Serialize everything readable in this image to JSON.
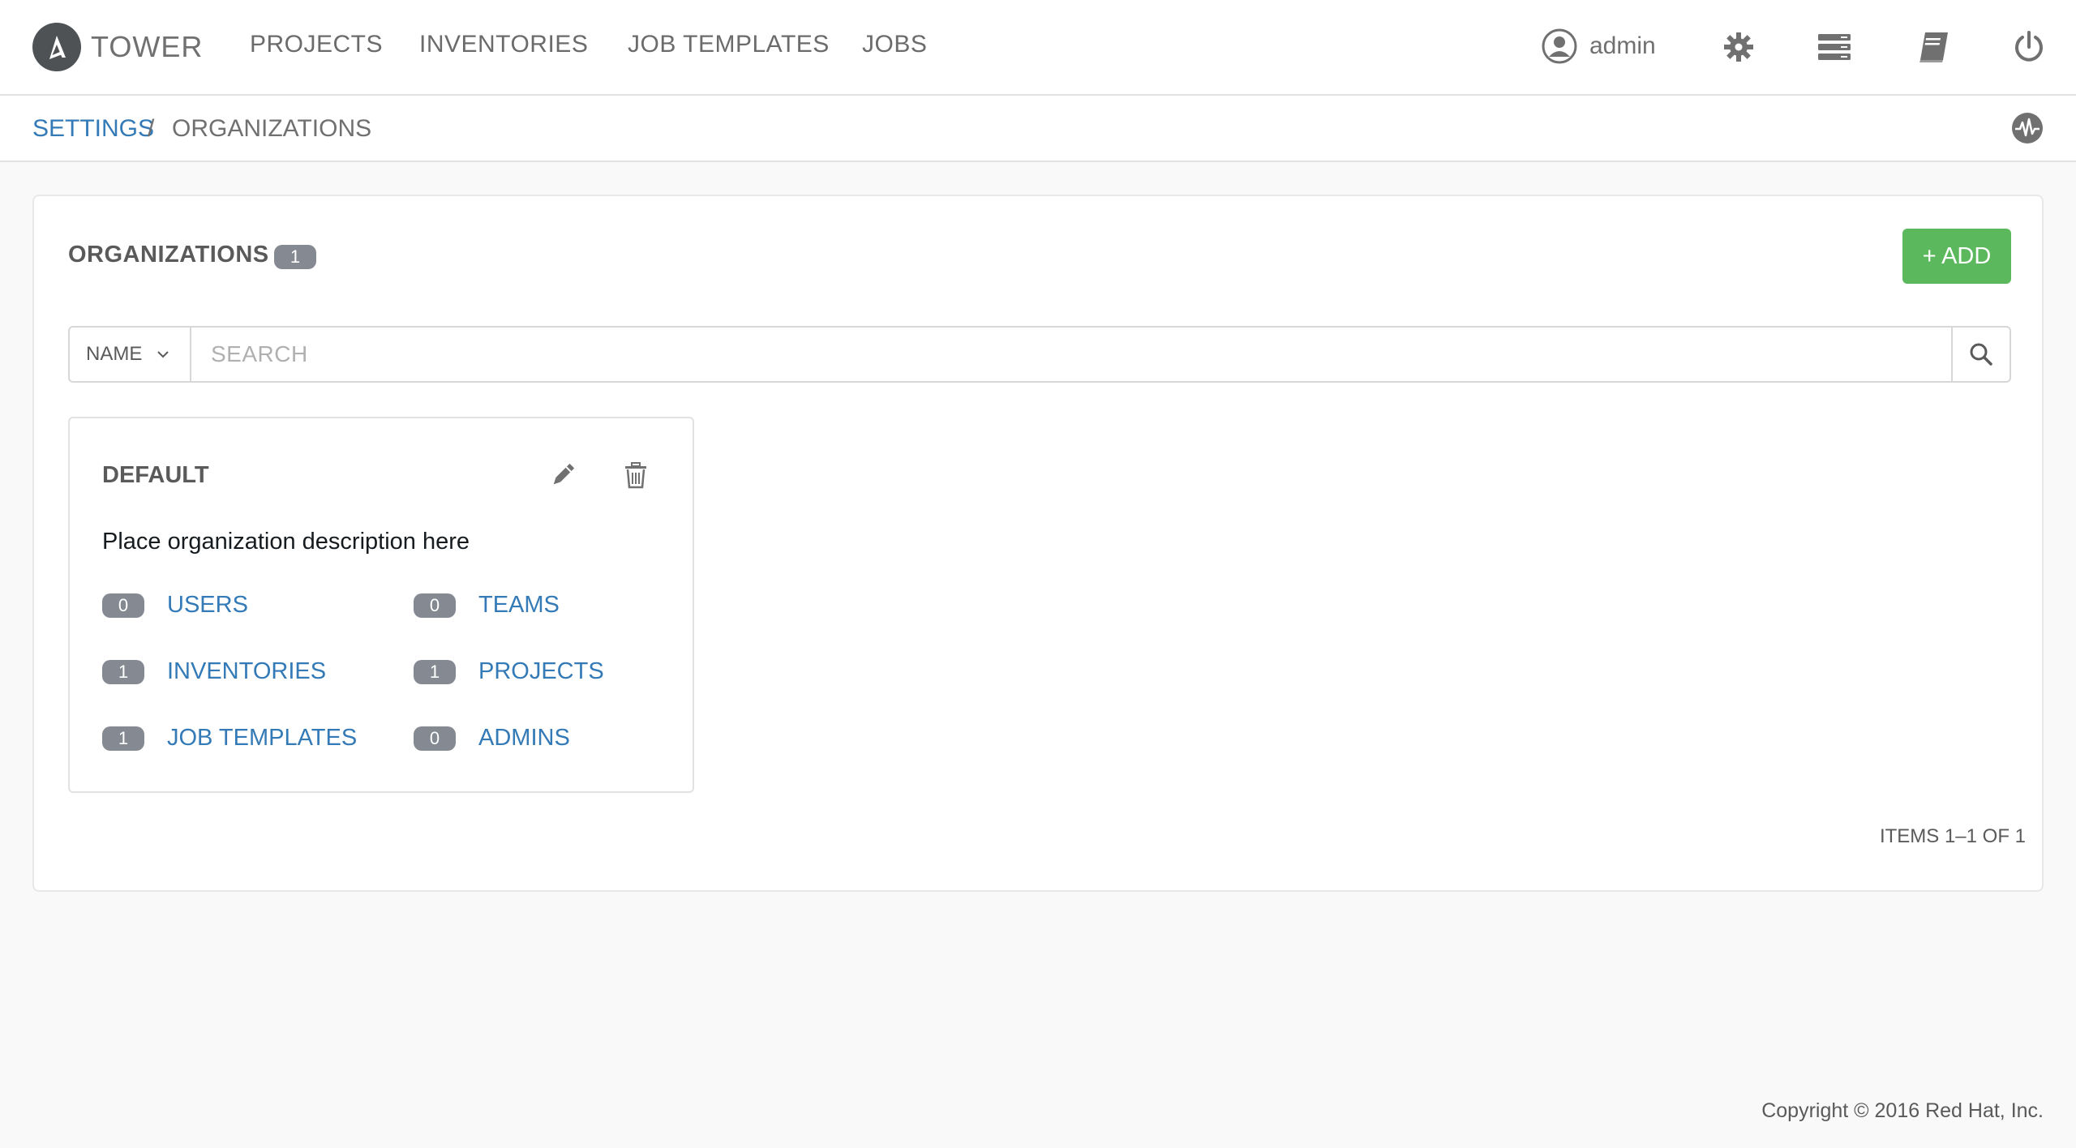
{
  "brand": {
    "logo_letter": "A",
    "name": "TOWER",
    "logo_color": "#4f5254"
  },
  "nav": {
    "items": [
      {
        "label": "PROJECTS"
      },
      {
        "label": "INVENTORIES"
      },
      {
        "label": "JOB TEMPLATES"
      },
      {
        "label": "JOBS"
      }
    ],
    "user": {
      "name": "admin",
      "icon": "user-circle-icon"
    },
    "icons": [
      "settings-gear-icon",
      "inventory-list-icon",
      "docs-book-icon",
      "power-icon"
    ]
  },
  "breadcrumb": {
    "parent": "SETTINGS",
    "separator": "/",
    "current": "ORGANIZATIONS",
    "activity_icon": "activity-stream-icon"
  },
  "organizations": {
    "title": "ORGANIZATIONS",
    "count": "1",
    "add_label": "+ ADD",
    "search": {
      "field": "NAME",
      "placeholder": "SEARCH"
    },
    "cards": [
      {
        "name": "DEFAULT",
        "description": "Place organization description here",
        "stats": [
          {
            "count": "0",
            "label": "USERS"
          },
          {
            "count": "0",
            "label": "TEAMS"
          },
          {
            "count": "1",
            "label": "INVENTORIES"
          },
          {
            "count": "1",
            "label": "PROJECTS"
          },
          {
            "count": "1",
            "label": "JOB TEMPLATES"
          },
          {
            "count": "0",
            "label": "ADMINS"
          }
        ]
      }
    ],
    "pager": "ITEMS 1–1 OF 1"
  },
  "footer": {
    "copyright": "Copyright © 2016 Red Hat, Inc."
  },
  "colors": {
    "link": "#337ab7",
    "add_button": "#5cb85c",
    "badge": "#848992",
    "nav_text": "#6b6b6b"
  }
}
